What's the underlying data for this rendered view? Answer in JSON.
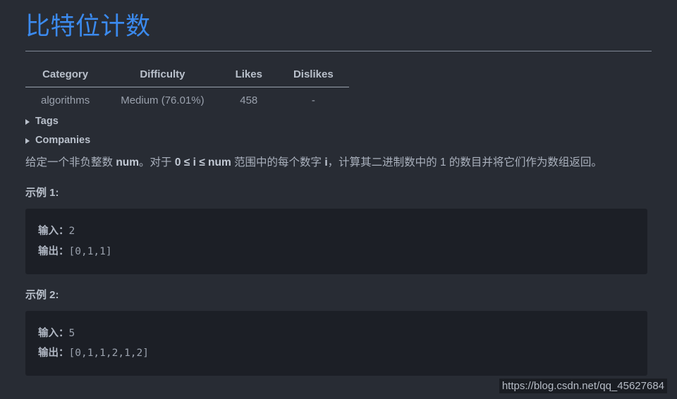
{
  "page": {
    "title": "比特位计数",
    "title_color": "#3b8aee",
    "background_color": "#282c34",
    "code_background_color": "#1c1f26"
  },
  "meta_table": {
    "headers": [
      "Category",
      "Difficulty",
      "Likes",
      "Dislikes"
    ],
    "rows": [
      [
        "algorithms",
        "Medium (76.01%)",
        "458",
        "-"
      ]
    ]
  },
  "details": [
    {
      "label": "Tags",
      "marker": "triangle-right-icon",
      "expanded": false
    },
    {
      "label": "Companies",
      "marker": "triangle-right-icon",
      "expanded": false
    }
  ],
  "description": {
    "part1": "给定一个非负整数 ",
    "bold1": "num",
    "part2": "。对于 ",
    "bold2": "0 ≤ i ≤ num",
    "part3": " 范围中的每个数字 ",
    "bold3": "i",
    "part4": "，计算其二进制数中的 1 的数目并将它们作为数组返回。"
  },
  "examples": [
    {
      "heading": "示例 1:",
      "input_label": "输入：",
      "input_value": "2",
      "output_label": "输出：",
      "output_value": "[0,1,1]"
    },
    {
      "heading": "示例 2:",
      "input_label": "输入：",
      "input_value": "5",
      "output_label": "输出：",
      "output_value": "[0,1,1,2,1,2]"
    }
  ],
  "watermark": "https://blog.csdn.net/qq_45627684"
}
